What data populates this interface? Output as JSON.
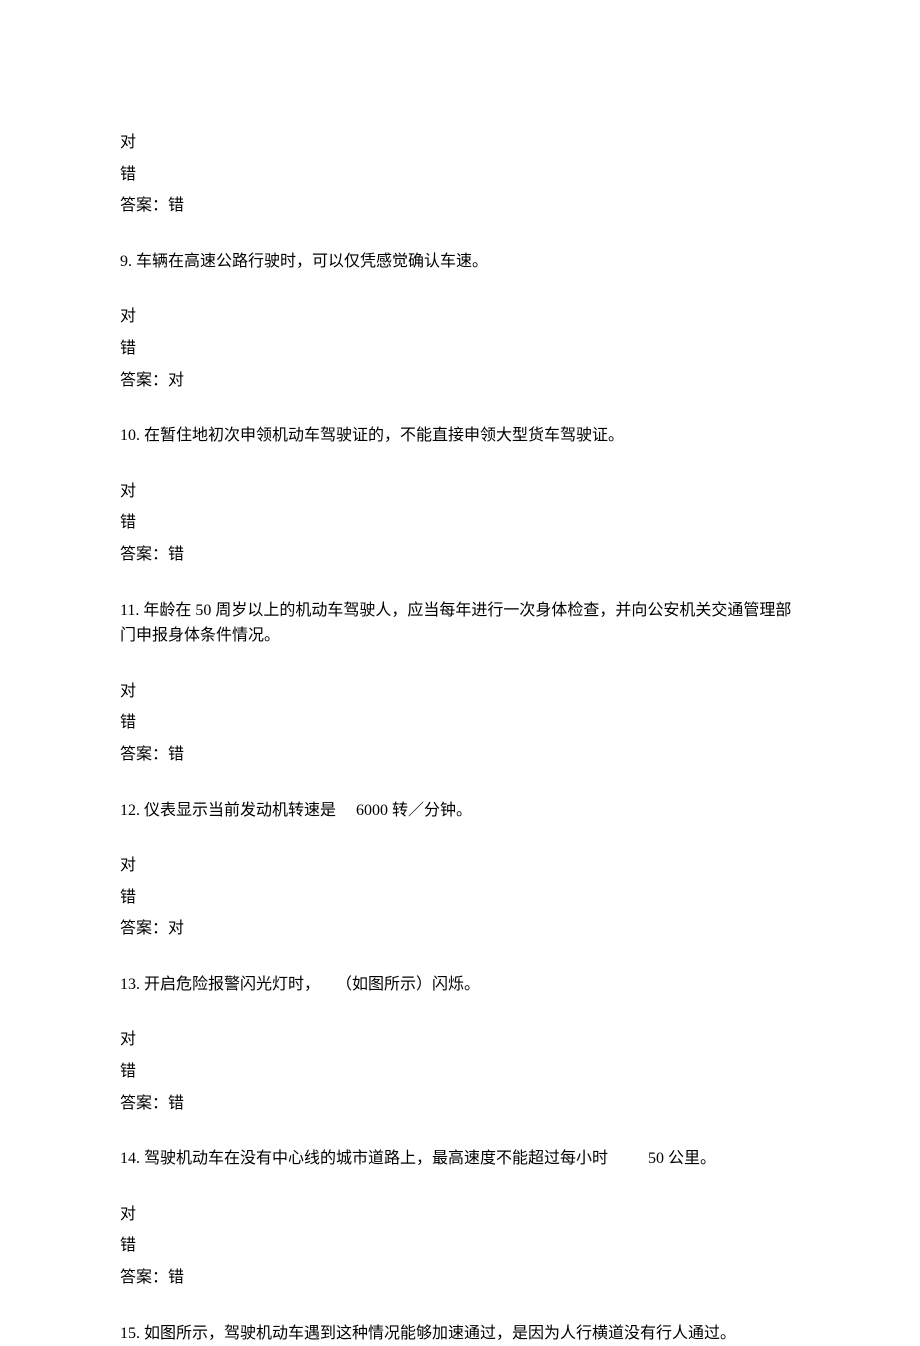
{
  "intro": {
    "option_true": "对",
    "option_false": "错",
    "answer_label": "答案：",
    "answer_value": "错"
  },
  "questions": [
    {
      "number": "9.",
      "text": "车辆在高速公路行驶时，可以仅凭感觉确认车速。",
      "option_true": "对",
      "option_false": "错",
      "answer_label": "答案：",
      "answer_value": "对"
    },
    {
      "number": "10.",
      "text": "在暂住地初次申领机动车驾驶证的，不能直接申领大型货车驾驶证。",
      "option_true": "对",
      "option_false": "错",
      "answer_label": "答案：",
      "answer_value": "错"
    },
    {
      "number": "11.",
      "text": "年龄在 50 周岁以上的机动车驾驶人，应当每年进行一次身体检查，并向公安机关交通管理部门申报身体条件情况。",
      "option_true": "对",
      "option_false": "错",
      "answer_label": "答案：",
      "answer_value": "错"
    },
    {
      "number": "12.",
      "text_prefix": "仪表显示当前发动机转速是",
      "text_suffix": "6000 转／分钟。",
      "option_true": "对",
      "option_false": "错",
      "answer_label": "答案：",
      "answer_value": "对"
    },
    {
      "number": "13.",
      "text_prefix": "开启危险报警闪光灯时，",
      "text_suffix": "（如图所示）闪烁。",
      "option_true": "对",
      "option_false": "错",
      "answer_label": "答案：",
      "answer_value": "错"
    },
    {
      "number": "14.",
      "text_prefix": "驾驶机动车在没有中心线的城市道路上，最高速度不能超过每小时",
      "text_suffix": "50 公里。",
      "option_true": "对",
      "option_false": "错",
      "answer_label": "答案：",
      "answer_value": "错"
    },
    {
      "number": "15.",
      "text": "如图所示，驾驶机动车遇到这种情况能够加速通过，是因为人行横道没有行人通过。"
    }
  ]
}
